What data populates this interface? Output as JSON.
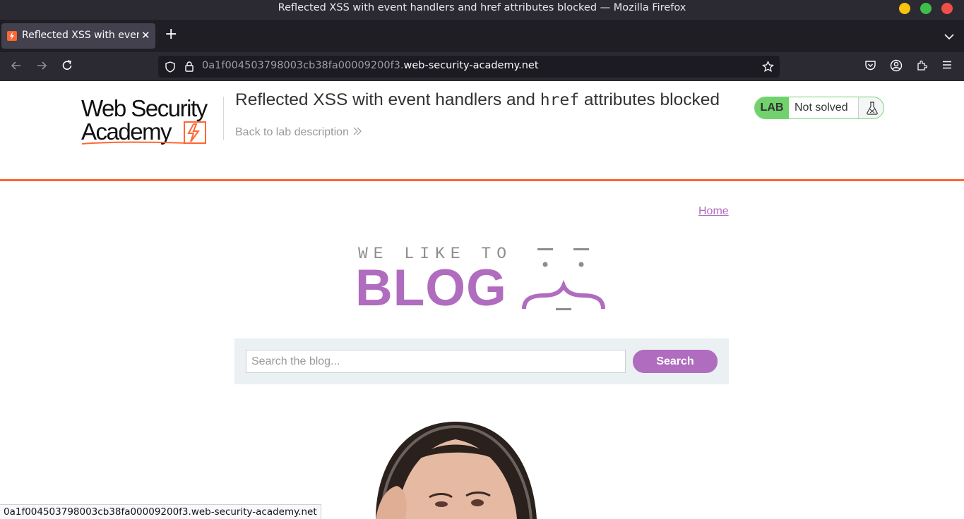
{
  "window": {
    "title": "Reflected XSS with event handlers and href attributes blocked — Mozilla Firefox"
  },
  "tabs": [
    {
      "label": "Reflected XSS with event handlers and href attributes blocked",
      "active": true
    }
  ],
  "navbar": {
    "url_host_prefix": "0a1f004503798003cb38fa00009200f3.",
    "url_domain": "web-security-academy.net"
  },
  "academy": {
    "logo_line1": "Web Security",
    "logo_line2": "Academy",
    "lab_title_pre": "Reflected XSS with event handlers and ",
    "lab_title_code": "href",
    "lab_title_post": " attributes blocked",
    "back_link": "Back to lab description",
    "lab_badge": "LAB",
    "lab_status": "Not solved",
    "accent_color": "#ff6633",
    "status_color": "#70d16d"
  },
  "blog": {
    "home_link": "Home",
    "tagline": "WE LIKE TO",
    "banner_word": "BLOG",
    "brand_color": "#b06cbf",
    "search": {
      "placeholder": "Search the blog...",
      "value": "",
      "button_label": "Search"
    }
  },
  "statusbar": {
    "hover_url": "0a1f004503798003cb38fa00009200f3.web-security-academy.net"
  }
}
